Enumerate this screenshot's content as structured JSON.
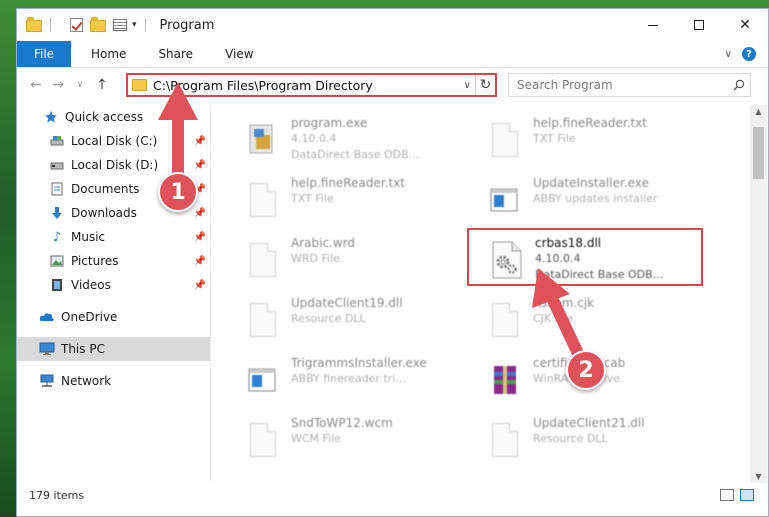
{
  "window": {
    "title": "Program"
  },
  "ribbon": {
    "tabs": [
      "File",
      "Home",
      "Share",
      "View"
    ],
    "help": "?"
  },
  "address": {
    "path": "C:\\Program Files\\Program Directory"
  },
  "search": {
    "placeholder": "Search Program"
  },
  "nav": {
    "quick_access": "Quick access",
    "items": [
      {
        "label": "Local Disk (C:)",
        "icon": "drive-icon"
      },
      {
        "label": "Local Disk (D:)",
        "icon": "drive-icon"
      },
      {
        "label": "Documents",
        "icon": "documents-icon"
      },
      {
        "label": "Downloads",
        "icon": "downloads-icon"
      },
      {
        "label": "Music",
        "icon": "music-icon"
      },
      {
        "label": "Pictures",
        "icon": "pictures-icon"
      },
      {
        "label": "Videos",
        "icon": "videos-icon"
      }
    ],
    "onedrive": "OneDrive",
    "thispc": "This PC",
    "network": "Network"
  },
  "files": [
    {
      "name": "program.exe",
      "line2": "4.10.0.4",
      "line3": "DataDirect Base ODB..."
    },
    {
      "name": "help.fineReader.txt",
      "line2": "TXT File",
      "line3": ""
    },
    {
      "name": "help.fineReader.txt",
      "line2": "TXT File",
      "line3": ""
    },
    {
      "name": "UpdateInstaller.exe",
      "line2": "ABBY updates installer",
      "line3": ""
    },
    {
      "name": "Arabic.wrd",
      "line2": "WRD File",
      "line3": ""
    },
    {
      "name": "crbas18.dll",
      "line2": "4.10.0.4",
      "line3": "DataDirect Base ODB..."
    },
    {
      "name": "UpdateClient19.dll",
      "line2": "Resource DLL",
      "line3": ""
    },
    {
      "name": "KsKom.cjk",
      "line2": "CJK File",
      "line3": ""
    },
    {
      "name": "TrigrammsInstaller.exe",
      "line2": "ABBY finereader tri...",
      "line3": ""
    },
    {
      "name": "certificates.cab",
      "line2": "WinRAR archive",
      "line3": ""
    },
    {
      "name": "SndToWP12.wcm",
      "line2": "WCM File",
      "line3": ""
    },
    {
      "name": "UpdateClient21.dll",
      "line2": "Resource DLL",
      "line3": ""
    }
  ],
  "status": {
    "count": "179 items"
  },
  "annotations": {
    "one": "1",
    "two": "2"
  },
  "colors": {
    "accent": "#1979ca",
    "highlight": "#d9434a",
    "badge": "#e0525a"
  }
}
